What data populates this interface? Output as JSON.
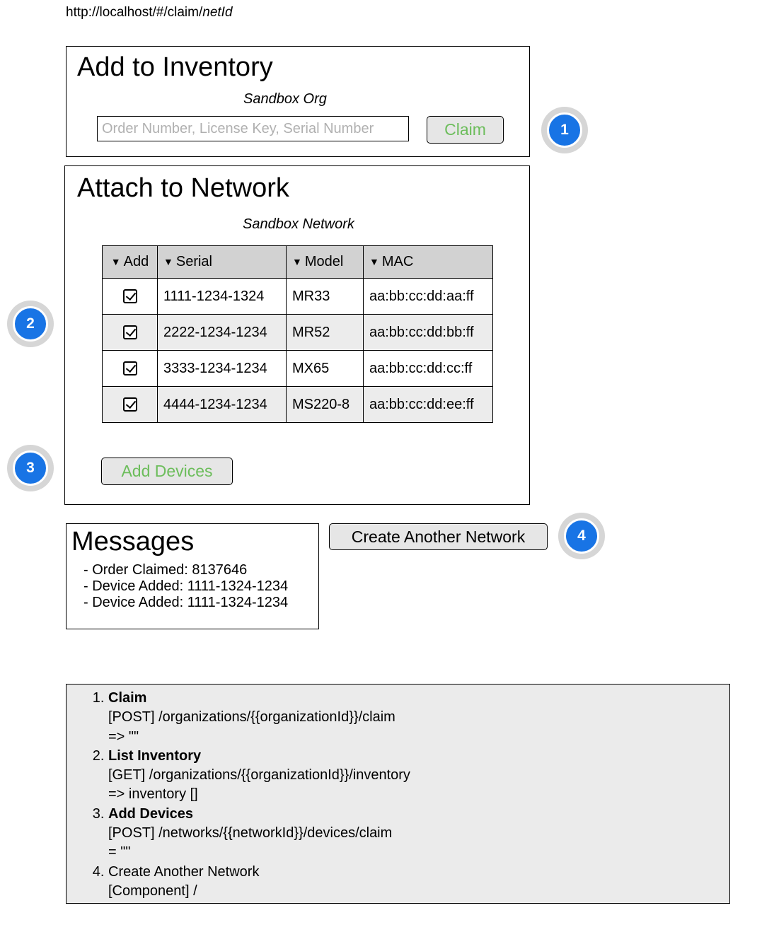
{
  "url": {
    "prefix": "http://localhost/#/claim/",
    "param": "netId"
  },
  "inventory": {
    "title": "Add to Inventory",
    "org": "Sandbox Org",
    "input_placeholder": "Order Number, License Key, Serial Number",
    "claim_label": "Claim"
  },
  "network": {
    "title": "Attach to Network",
    "network_name": "Sandbox Network",
    "columns": [
      "Add",
      "Serial",
      "Model",
      "MAC"
    ],
    "rows": [
      {
        "checked": true,
        "serial": "1111-1234-1324",
        "model": "MR33",
        "mac": "aa:bb:cc:dd:aa:ff"
      },
      {
        "checked": true,
        "serial": "2222-1234-1234",
        "model": "MR52",
        "mac": "aa:bb:cc:dd:bb:ff"
      },
      {
        "checked": true,
        "serial": "3333-1234-1234",
        "model": "MX65",
        "mac": "aa:bb:cc:dd:cc:ff"
      },
      {
        "checked": true,
        "serial": "4444-1234-1234",
        "model": "MS220-8",
        "mac": "aa:bb:cc:dd:ee:ff"
      }
    ],
    "add_devices_label": "Add Devices"
  },
  "messages": {
    "title": "Messages",
    "items": [
      "- Order Claimed: 8137646",
      "- Device Added: 1111-1324-1234",
      "- Device Added: 1111-1324-1234"
    ]
  },
  "create_network_label": "Create Another Network",
  "callouts": [
    "1",
    "2",
    "3",
    "4"
  ],
  "notes": [
    {
      "title": "Claim",
      "bold": true,
      "lines": [
        "[POST] /organizations/{{organizationId}}/claim",
        "=> \"\""
      ]
    },
    {
      "title": "List Inventory",
      "bold": true,
      "lines": [
        "[GET] /organizations/{{organizationId}}/inventory",
        "=> inventory []"
      ]
    },
    {
      "title": "Add Devices",
      "bold": true,
      "lines": [
        "[POST] /networks/{{networkId}}/devices/claim",
        "= \"\""
      ]
    },
    {
      "title": "Create Another Network",
      "bold": false,
      "lines": [
        "[Component] /"
      ]
    }
  ],
  "colors": {
    "accent_green": "#6cbd5b",
    "callout_blue": "#1874e5",
    "header_gray": "#d2d2d2"
  }
}
